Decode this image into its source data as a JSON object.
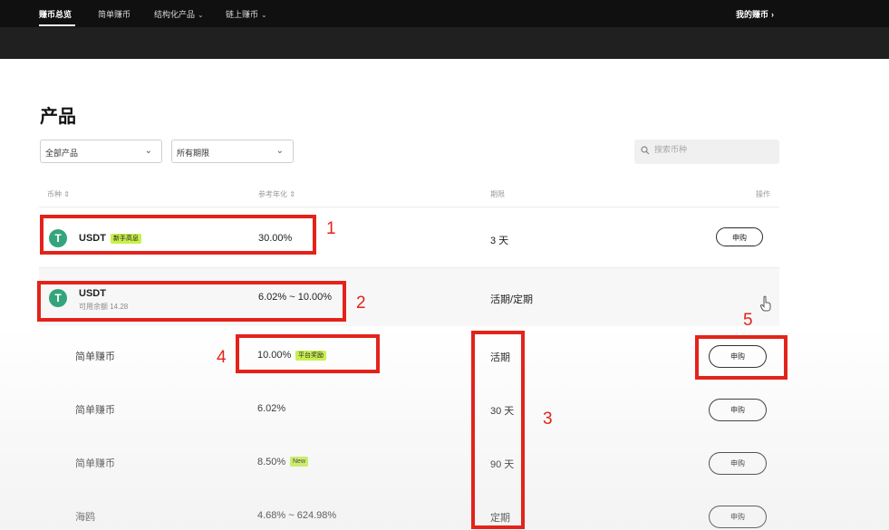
{
  "topnav": {
    "items": [
      {
        "label": "赚币总览"
      },
      {
        "label": "简单赚币"
      },
      {
        "label": "结构化产品"
      },
      {
        "label": "链上赚币"
      }
    ],
    "my_earn": "我的赚币"
  },
  "page": {
    "title": "产品"
  },
  "filters": {
    "product_select": "全部产品",
    "term_select": "所有期限",
    "search_placeholder": "搜索币种"
  },
  "table": {
    "headers": [
      "币种",
      "参考年化",
      "期限",
      "操作"
    ],
    "rows": [
      {
        "coin": "USDT",
        "tag": "新手高息",
        "apr": "30.00%",
        "term": "3 天",
        "action": "申购"
      },
      {
        "coin": "USDT",
        "sub": "可用余额 14.28",
        "apr": "6.02% ~ 10.00%",
        "term": "活期/定期"
      },
      {
        "name": "简单赚币",
        "apr": "10.00%",
        "tag": "平台奖励",
        "term": "活期",
        "action": "申购"
      },
      {
        "name": "简单赚币",
        "apr": "6.02%",
        "term": "30 天",
        "action": "申购"
      },
      {
        "name": "简单赚币",
        "apr": "8.50%",
        "tag": "New",
        "term": "90 天",
        "action": "申购"
      },
      {
        "name": "海鸥",
        "apr": "4.68% ~ 624.98%",
        "term": "定期",
        "action": "申购"
      }
    ]
  },
  "annotations": [
    "1",
    "2",
    "3",
    "4",
    "5"
  ],
  "colors": {
    "annotation": "#e3231b",
    "tag": "#c8f04a",
    "usdt": "#35a47d"
  }
}
